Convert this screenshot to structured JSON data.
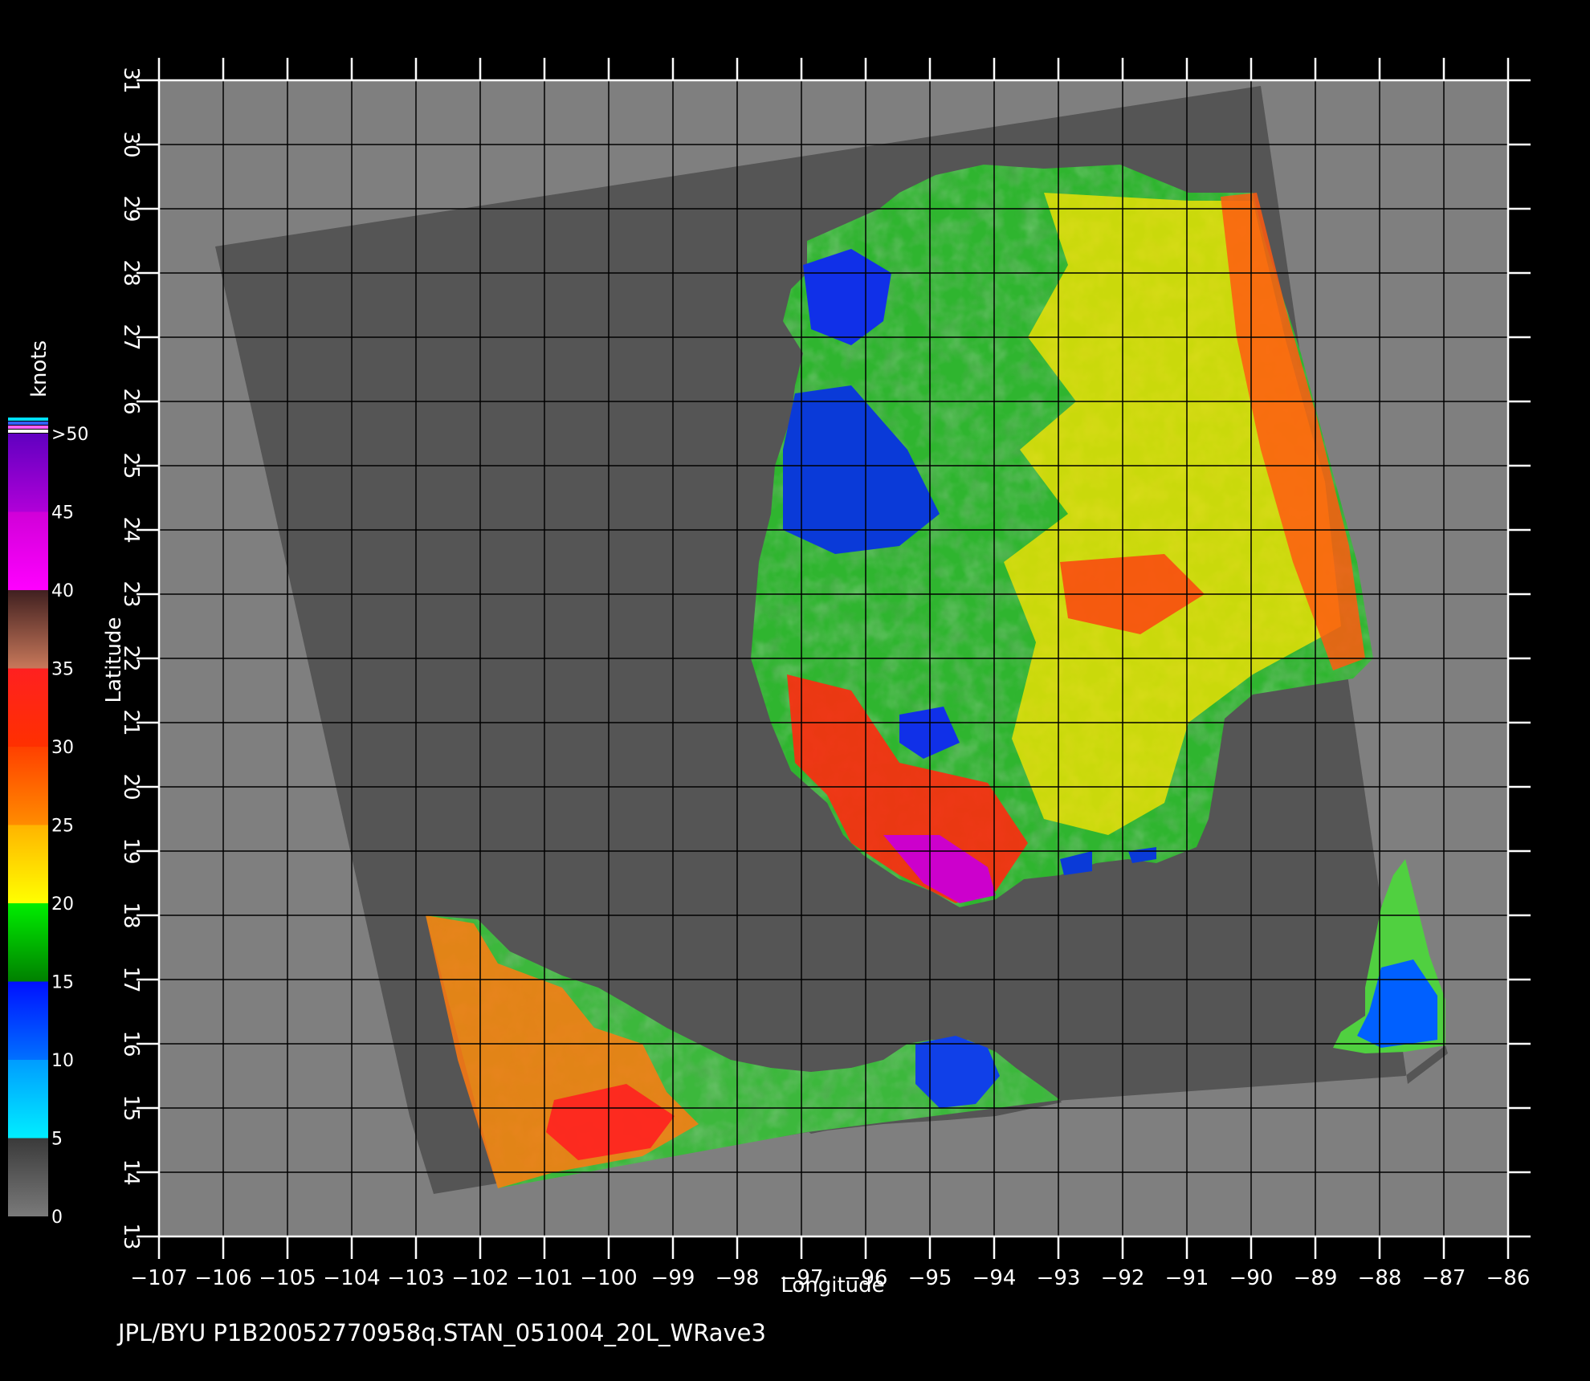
{
  "map": {
    "footer": "JPL/BYU  P1B20052770958q.STAN_051004_20L_WRave3",
    "x_axis_title": "Longitude",
    "y_axis_title": "Latitude",
    "lon_range": [
      -107,
      -86
    ],
    "lat_range": [
      13,
      31
    ],
    "lon_ticks": [
      "-107",
      "-106",
      "-105",
      "-104",
      "-103",
      "-102",
      "-101",
      "-100",
      "-99",
      "-98",
      "-97",
      "-96",
      "-95",
      "-94",
      "-93",
      "-92",
      "-91",
      "-90",
      "-89",
      "-88",
      "-87",
      "-86"
    ],
    "lat_ticks": [
      "13",
      "14",
      "15",
      "16",
      "17",
      "18",
      "19",
      "20",
      "21",
      "22",
      "23",
      "24",
      "25",
      "26",
      "27",
      "28",
      "29",
      "30",
      "31"
    ],
    "grid": true,
    "colors": {
      "land": "#7f7f7f",
      "swath": "#555555",
      "grid": "#000000",
      "frame": "#ffffff"
    }
  },
  "colorbar": {
    "unit": "knots",
    "labels": [
      ">50",
      "45",
      "40",
      "35",
      "30",
      "25",
      "20",
      "15",
      "10",
      "5",
      "0"
    ],
    "segments": [
      {
        "from": 0,
        "to": 5,
        "color_top": "#3a3a3a",
        "color_bottom": "#7a7a7a"
      },
      {
        "from": 5,
        "to": 10,
        "color_top": "#009cff",
        "color_bottom": "#00eeff"
      },
      {
        "from": 10,
        "to": 15,
        "color_top": "#0010ff",
        "color_bottom": "#0070ff"
      },
      {
        "from": 15,
        "to": 20,
        "color_top": "#00ee00",
        "color_bottom": "#008000"
      },
      {
        "from": 20,
        "to": 25,
        "color_top": "#ffb400",
        "color_bottom": "#ffff00"
      },
      {
        "from": 25,
        "to": 30,
        "color_top": "#ff4000",
        "color_bottom": "#ff8c00"
      },
      {
        "from": 30,
        "to": 35,
        "color_top": "#ff2020",
        "color_bottom": "#ff3000"
      },
      {
        "from": 35,
        "to": 40,
        "color_top": "#402020",
        "color_bottom": "#c8785a"
      },
      {
        "from": 40,
        "to": 45,
        "color_top": "#d000d8",
        "color_bottom": "#ff00ff"
      },
      {
        "from": 45,
        "to": 50,
        "color_top": "#6000c0",
        "color_bottom": "#b000d8"
      }
    ],
    "cap_colors": [
      "#00e0ff",
      "#3060ff",
      "#ff60ff",
      "#ffffff"
    ]
  }
}
